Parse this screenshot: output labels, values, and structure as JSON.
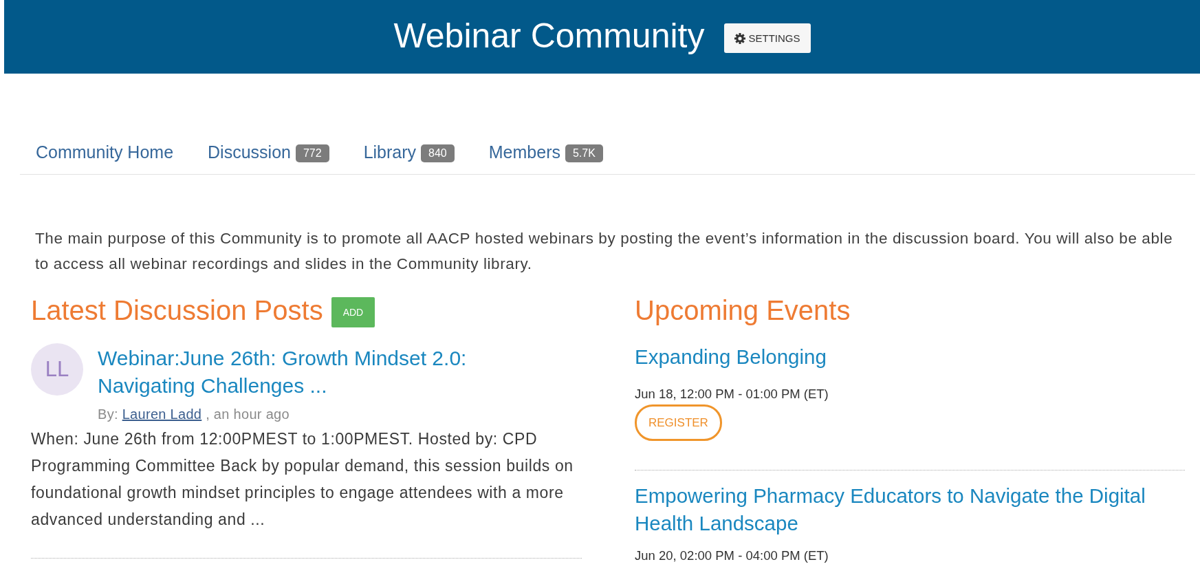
{
  "header": {
    "title": "Webinar Community",
    "settings_button": "SETTINGS"
  },
  "tabs": [
    {
      "label": "Community Home",
      "selected": false
    },
    {
      "label": "Discussion",
      "count": "772",
      "selected": false
    },
    {
      "label": "Library",
      "count": "840",
      "selected": false
    },
    {
      "label": "Members",
      "count": "5.7K",
      "selected": false
    }
  ],
  "intro": "The main purpose of this Community is to promote all AACP hosted webinars by posting the event’s information in the discussion board. You will also be able to access all webinar recordings and slides in the Community library.",
  "discussion": {
    "heading": "Latest Discussion Posts",
    "add_button": "ADD",
    "posts": [
      {
        "initials": "LL",
        "title": "Webinar:June 26th: Growth Mindset 2.0: Navigating Challenges ...",
        "by_label": "By:",
        "author": "Lauren Ladd",
        "posted": ", an hour ago",
        "excerpt": "When: June 26th from 12:00PMEST to 1:00PMEST. Hosted by: CPD Programming Committee Back by popular demand, this session builds on foundational growth mindset principles to engage attendees with a more advanced understanding and ..."
      }
    ]
  },
  "events": {
    "heading": "Upcoming Events",
    "items": [
      {
        "title": "Expanding Belonging",
        "when": "Jun 18, 12:00 PM - 01:00 PM (ET)",
        "register_button": "REGISTER"
      },
      {
        "title": "Empowering Pharmacy Educators to Navigate the Digital Health Landscape",
        "when": "Jun 20, 02:00 PM - 04:00 PM (ET)"
      }
    ]
  }
}
